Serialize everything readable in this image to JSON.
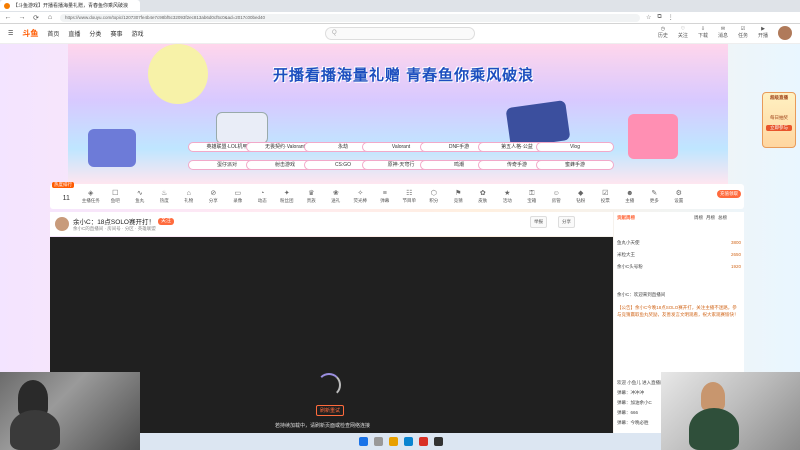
{
  "browser": {
    "tab_title": "【斗鱼游戏】开播看播海量礼赠，青春鱼你乘风破浪",
    "url": "https://www.douyu.com/topic/1207307fe4b4e7c98bf5c32093f2ec813ab6d0cf5c0&ad=2017c00bed40",
    "nav_back": "←",
    "nav_forward": "→",
    "nav_reload": "⟳",
    "nav_home": "⌂"
  },
  "header": {
    "logo": "斗鱼",
    "nav": [
      "首页",
      "直播",
      "分类",
      "赛事",
      "游戏"
    ],
    "search_placeholder": "Q",
    "icons": [
      "历史",
      "关注",
      "下载",
      "消息",
      "任务",
      "开播"
    ]
  },
  "banner": {
    "title": "开播看播海量礼赠 青春鱼你乘风破浪",
    "chips": [
      "英雄联盟·LOL机甲",
      "无畏契约·Valorant",
      "永劫",
      "Valorant",
      "DNF手游",
      "第五人格·公益",
      "Vlog",
      "蛋仔派对",
      "射击游戏",
      "CS:GO",
      "原神·天穹行",
      "鸣潮",
      "传奇手游",
      "蜜蜂手游"
    ]
  },
  "side_promo": {
    "title": "超级直播",
    "line1": "每日抽奖",
    "line2": "立即参与"
  },
  "toolbar": {
    "hot_badge": "热度排行",
    "hot_count": "11",
    "recharge": "充值领取",
    "items": [
      "主播任务",
      "鱼吧",
      "鱼丸",
      "热度",
      "礼物",
      "分享",
      "录像",
      "动态",
      "粉丝团",
      "贵族",
      "送礼",
      "荧光棒",
      "弹幕",
      "节目单",
      "积分",
      "竞猜",
      "皮肤",
      "活动",
      "宝箱",
      "房管",
      "钻粉",
      "投票",
      "主播",
      "更多",
      "设置"
    ]
  },
  "room": {
    "streamer_name": "余小C",
    "title": "余小C：18点SOLO赛开打！",
    "follow": "关注",
    "sub": "余小C的直播间  · 房间号 · 分区 · 英雄联盟",
    "button_report": "举报",
    "button_share": "分享"
  },
  "video": {
    "load_button": "刷新重试",
    "load_text": "若持续加载中，请刷新页面或检查网络连接"
  },
  "chat": {
    "rank_title": "贡献周榜",
    "rank_tabs": [
      "周榜",
      "月榜",
      "总榜"
    ],
    "ranks": [
      {
        "name": "鱼丸小天使",
        "value": "3800"
      },
      {
        "name": "米粒大王",
        "value": "2650"
      },
      {
        "name": "余小C头号粉",
        "value": "1920"
      }
    ],
    "messages": [
      "余小C：欢迎来到直播间",
      "【公告】余小C今晚18点SOLO赛开打，关注主播不迷路，参与竞猜赢取鱼丸奖励，友善发言文明观看，祝大家观赛愉快！",
      "欢迎 小鱼儿 进入直播间",
      "弹幕：冲冲冲",
      "弹幕：加油余小C",
      "弹幕：666",
      "弹幕：今晚必胜"
    ]
  },
  "cameras": {
    "left": "streamer-left",
    "right": "streamer-right"
  }
}
